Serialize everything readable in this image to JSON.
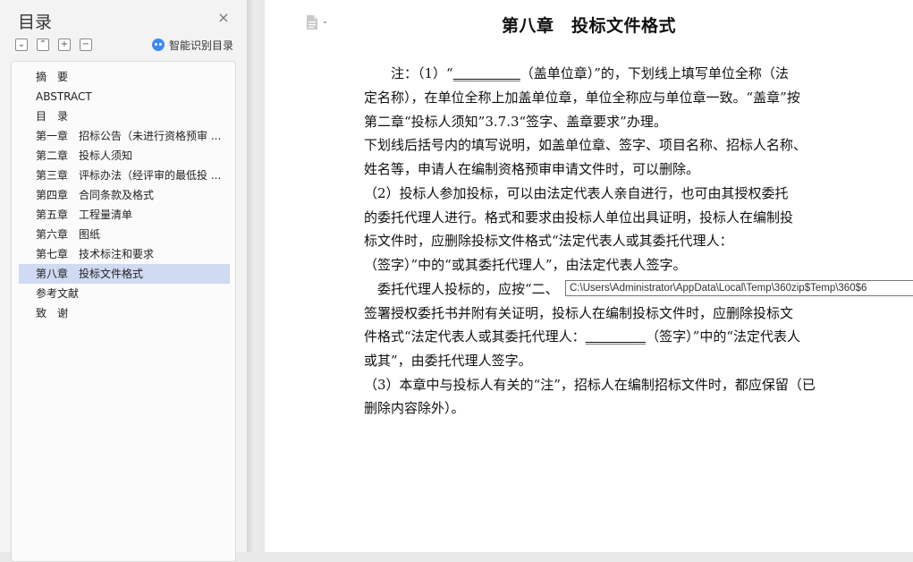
{
  "toc": {
    "title": "目录",
    "close_glyph": "×",
    "tools": [
      {
        "name": "collapse-all",
        "glyph": "⌄"
      },
      {
        "name": "expand-level",
        "glyph": "⌃"
      },
      {
        "name": "add-item",
        "glyph": "+"
      },
      {
        "name": "remove-item",
        "glyph": "−"
      }
    ],
    "ai_label": "智能识别目录",
    "items": [
      {
        "label": "摘　要"
      },
      {
        "label": "ABSTRACT"
      },
      {
        "label": "目　录"
      },
      {
        "label": "第一章　招标公告（未进行资格预审 ..."
      },
      {
        "label": "第二章　投标人须知"
      },
      {
        "label": "第三章　评标办法（经评审的最低投 ..."
      },
      {
        "label": "第四章　合同条款及格式"
      },
      {
        "label": "第五章　工程量清单"
      },
      {
        "label": "第六章　图纸"
      },
      {
        "label": "第七章　技术标注和要求"
      },
      {
        "label": "第八章　投标文件格式"
      },
      {
        "label": "参考文献"
      },
      {
        "label": "致　谢"
      }
    ],
    "active_index": 10
  },
  "document": {
    "chapter_title": "第八章　投标文件格式",
    "lines": {
      "l1a": "　　注：（1）“",
      "l1blank": "__________",
      "l1b": "（盖单位章）”的，下划线上填写单位全称（法",
      "l2": "定名称），在单位全称上加盖单位章，单位全称应与单位章一致。“盖章”按",
      "l3": "第二章“投标人须知”3.7.3“签字、盖章要求”办理。",
      "l4": "下划线后括号内的填写说明，如盖单位章、签字、项目名称、招标人名称、",
      "l5": "姓名等，申请人在编制资格预审申请文件时，可以删除。",
      "l6": "（2）投标人参加投标，可以由法定代表人亲自进行，也可由其授权委托",
      "l7": "的委托代理人进行。格式和要求由投标人单位出具证明，投标人在编制投",
      "l8": "标文件时，应删除投标文件格式“法定代表人或其委托代理人：",
      "l9": "（签字）”中的“或其委托代理人”，由法定代表人签字。",
      "l10": "　委托代理人投标的，应按“二、",
      "l11": "签署授权委托书并附有关证明，投标人在编制投标文件时，应删除投标文",
      "l12a": "件格式“法定代表人或其委托代理人：",
      "l12blank": "_________",
      "l12b": "（签字）”中的“法定代表人",
      "l13": "或其”，由委托代理人签字。",
      "l14": "（3）本章中与投标人有关的“注”，招标人在编制招标文件时，都应保留（已",
      "l15": "删除内容除外）。"
    },
    "tooltip_path": "C:\\Users\\Administrator\\AppData\\Local\\Temp\\360zip$Temp\\360$6"
  }
}
